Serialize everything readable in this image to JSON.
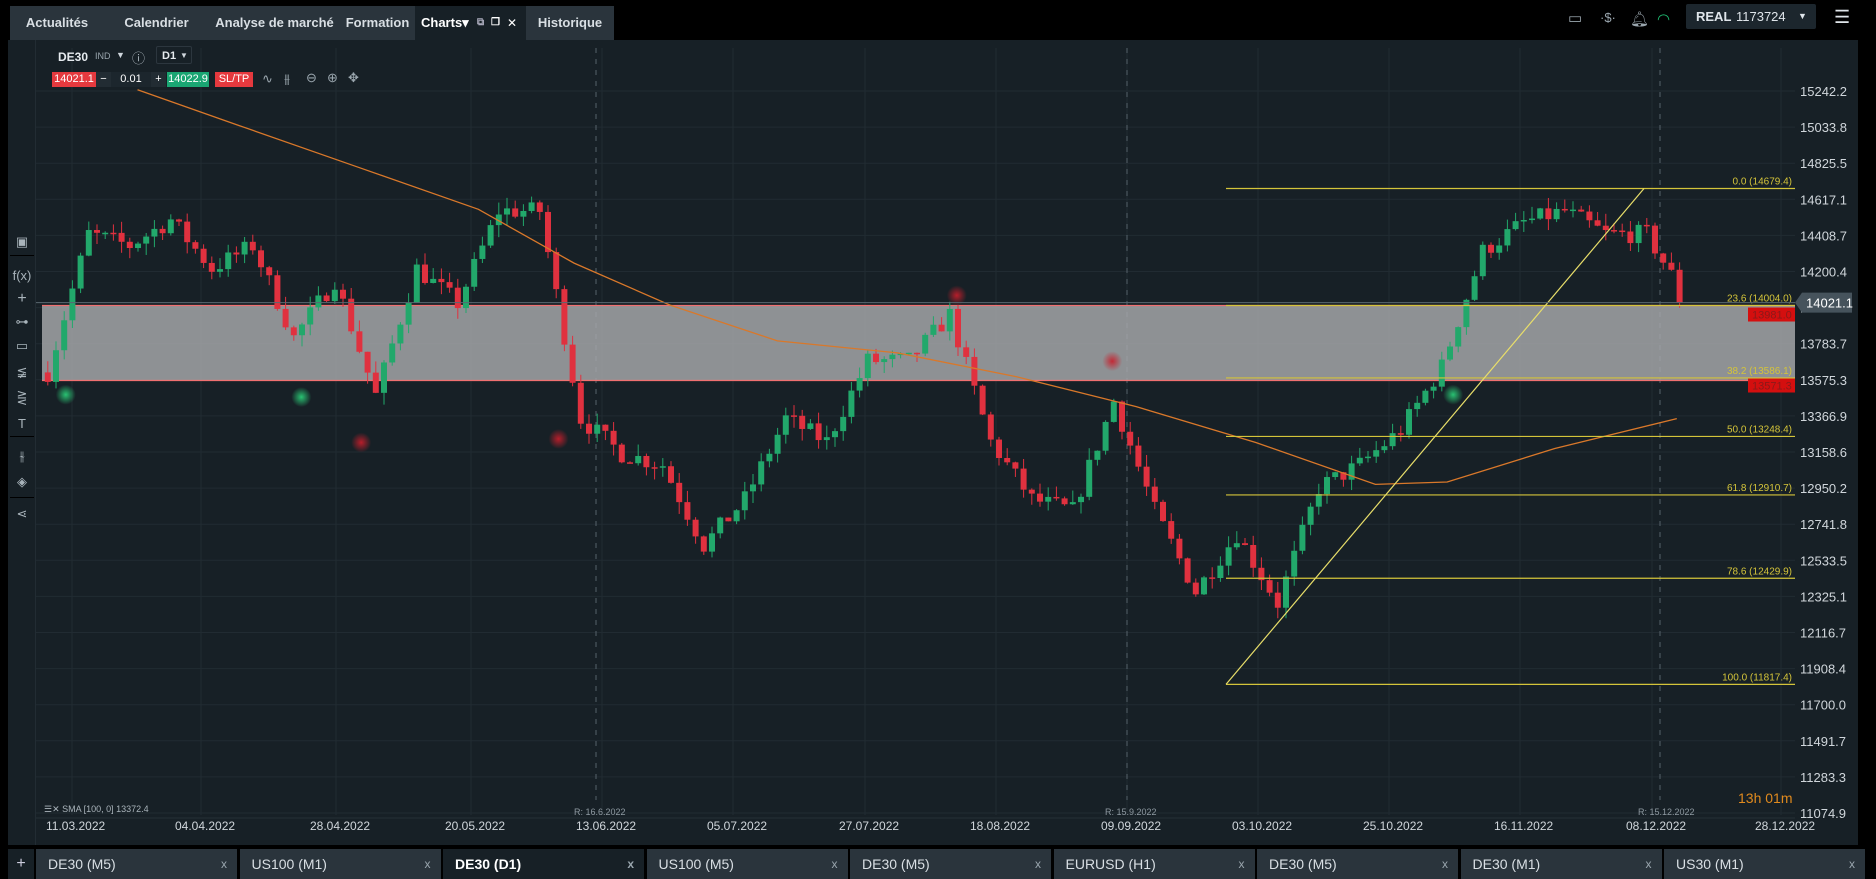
{
  "top_tabs": [
    {
      "label": "Actualités"
    },
    {
      "label": "Calendrier"
    },
    {
      "label": "Analyse de marché"
    },
    {
      "label": "Formation"
    },
    {
      "label": "Charts▾",
      "active": true
    },
    {
      "label": "Historique"
    }
  ],
  "account": {
    "mode": "REAL",
    "number": "1173724"
  },
  "symbol": {
    "name": "DE30",
    "type": "IND",
    "timeframe": "D1"
  },
  "trade": {
    "sell": "14021.1",
    "minus": "−",
    "volume": "0.01",
    "plus": "+",
    "buy": "14022.9",
    "sltp": "SL/TP"
  },
  "colors": {
    "bg": "#172026",
    "up": "#22a86b",
    "down": "#e0313f",
    "sma": "#d9782a",
    "fib": "#d4c43a",
    "zone": "#a3a6a8",
    "buy": "#1aa673",
    "sell": "#e5393e"
  },
  "price_axis": [
    "15242.2",
    "15033.8",
    "14825.5",
    "14617.1",
    "14408.7",
    "14200.4",
    "13992.0",
    "13783.7",
    "13575.3",
    "13366.9",
    "13158.6",
    "12950.2",
    "12741.8",
    "12533.5",
    "12325.1",
    "12116.7",
    "11908.4",
    "11700.0",
    "11491.7",
    "11283.3",
    "11074.9"
  ],
  "current_price": "14021.1",
  "date_axis": [
    "11.03.2022",
    "04.04.2022",
    "28.04.2022",
    "20.05.2022",
    "13.06.2022",
    "05.07.2022",
    "27.07.2022",
    "18.08.2022",
    "09.09.2022",
    "03.10.2022",
    "25.10.2022",
    "16.11.2022",
    "08.12.2022",
    "28.12.2022"
  ],
  "rollover_markers": [
    "R: 16.6.2022",
    "R: 15.9.2022",
    "R: 15.12.2022"
  ],
  "indicator_legend": "SMA [100, 0] 13372.4",
  "countdown": "13h 01m",
  "zone": {
    "top": "13981.0",
    "bottom": "13571.3"
  },
  "fibonacci": [
    {
      "label": "0.0 (14679.4)",
      "price": 14679.4
    },
    {
      "label": "23.6 (14004.0)",
      "price": 14004.0
    },
    {
      "label": "38.2 (13586.1)",
      "price": 13586.1
    },
    {
      "label": "50.0 (13248.4)",
      "price": 13248.4
    },
    {
      "label": "61.8 (12910.7)",
      "price": 12910.7
    },
    {
      "label": "78.6 (12429.9)",
      "price": 12429.9
    },
    {
      "label": "100.0 (11817.4)",
      "price": 11817.4
    }
  ],
  "approx_closes_every_5_days": [
    13618,
    14417,
    14350,
    14500,
    14217,
    14350,
    13818,
    14150,
    13485,
    14217,
    14017,
    14550,
    14550,
    13351,
    13150,
    13085,
    12620,
    12885,
    13352,
    13218,
    13685,
    13685,
    13950,
    13218,
    12885,
    12820,
    13452,
    12820,
    12353,
    12686,
    12287,
    12953,
    13085,
    13285,
    13651,
    14317,
    14484,
    14550,
    14417,
    14417,
    14021
  ],
  "bottom_tabs": [
    {
      "label": "DE30 (M5)"
    },
    {
      "label": "US100 (M1)"
    },
    {
      "label": "DE30 (D1)",
      "active": true
    },
    {
      "label": "US100 (M5)"
    },
    {
      "label": "DE30 (M5)"
    },
    {
      "label": "EURUSD (H1)"
    },
    {
      "label": "DE30 (M5)"
    },
    {
      "label": "DE30 (M1)"
    },
    {
      "label": "US30 (M1)"
    }
  ],
  "add_tab": "+",
  "close_glyph": "x"
}
